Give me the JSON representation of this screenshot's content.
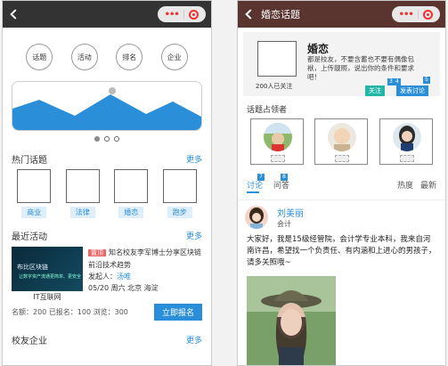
{
  "left": {
    "circles": [
      "话题",
      "活动",
      "排名",
      "企业"
    ],
    "hot_topics": {
      "title": "热门话题",
      "more": "更多",
      "tags": [
        "商业",
        "法律",
        "婚恋",
        "跑步"
      ]
    },
    "recent": {
      "title": "最近活动",
      "more": "更多",
      "hot": "置顶",
      "image_caption": "布比区块链",
      "image_caption2": "让数字资产流通更简单、更安全",
      "headline": "知名校友李军博士分享区块链前沿技术趋势",
      "organizer_label": "发起人：",
      "organizer": "汤唯",
      "datetime_location": "05/20 周六 北京 海淀",
      "source": "IT互联网",
      "stats": "名额：200 已报名：100  浏览：300",
      "signup": "立即报名"
    },
    "alumni": {
      "title": "校友企业",
      "more": "更多"
    }
  },
  "right": {
    "title": "婚恋话题",
    "topic": {
      "name": "婚恋",
      "desc": "都是校友，不要含蓄也不要有偶像包袱，上传靓照，说出你的条件和要求吧！",
      "followers": "200人已关注",
      "follow": "关注",
      "post": "发表讨论",
      "badge3": "3",
      "badge4": "4",
      "badge5": "5"
    },
    "leaders_title": "话题占领者",
    "tabs": {
      "discuss": "讨论",
      "qa": "问答",
      "hot": "热度",
      "new": "最新",
      "badge7": "7",
      "badge8": "8"
    },
    "post": {
      "name": "刘美丽",
      "role": "会计",
      "text": "大家好，我是15级经管院，会计学专业本科，我来自河南许昌，希望找一个负责任、有内涵和上进心的男孩子，请多关照哦~"
    }
  },
  "colors": {
    "accent_blue": "#2a8fd8",
    "right_bar": "#5a3530",
    "left_bar": "#333333",
    "hot": "#e66666"
  }
}
